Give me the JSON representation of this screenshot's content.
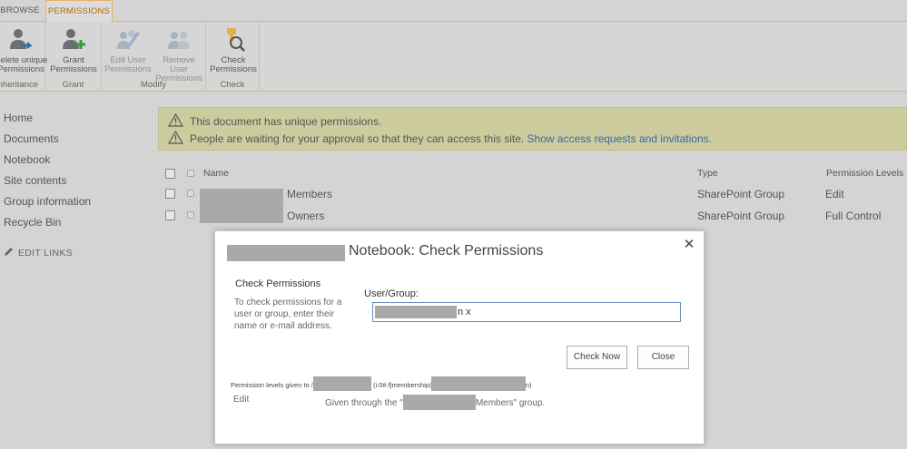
{
  "tabs": {
    "browse": "BROWSE",
    "permissions": "PERMISSIONS"
  },
  "ribbon": {
    "groups": [
      {
        "name": "Inheritance",
        "buttons": [
          {
            "line1": "Delete unique",
            "line2": "Permissions"
          }
        ]
      },
      {
        "name": "Grant",
        "buttons": [
          {
            "line1": "Grant",
            "line2": "Permissions"
          }
        ]
      },
      {
        "name": "Modify",
        "buttons": [
          {
            "line1": "Edit User",
            "line2": "Permissions"
          },
          {
            "line1": "Remove User",
            "line2": "Permissions"
          }
        ]
      },
      {
        "name": "Check",
        "buttons": [
          {
            "line1": "Check",
            "line2": "Permissions"
          }
        ]
      }
    ]
  },
  "nav": {
    "items": [
      "Home",
      "Documents",
      "Notebook",
      "Site contents",
      "Group information",
      "Recycle Bin"
    ],
    "edit_links": "EDIT LINKS"
  },
  "status": {
    "line1": "This document has unique permissions.",
    "line2_text": "People are waiting for your approval so that they can access this site.",
    "line2_link": "Show access requests and invitations."
  },
  "table": {
    "headers": {
      "name": "Name",
      "type": "Type",
      "permission_levels": "Permission Levels"
    },
    "rows": [
      {
        "name_suffix": "Members",
        "type": "SharePoint Group",
        "level": "Edit"
      },
      {
        "name_suffix": "Owners",
        "type": "SharePoint Group",
        "level": "Full Control"
      }
    ]
  },
  "dialog": {
    "title": "Notebook: Check Permissions",
    "close_glyph": "✕",
    "section_title": "Check Permissions",
    "description": "To check permissions for a user or group, enter their name or e-mail address.",
    "field_label": "User/Group:",
    "field_value_visible": "n x",
    "check_now": "Check Now",
    "close": "Close",
    "result_prefix": "Permission levels given to /",
    "result_middle": "(i:0#.f|membership|",
    "result_suffix": "n)",
    "result_level": "Edit",
    "result_given_prefix": "Given through the \"",
    "result_given_suffix": "Members\" group."
  },
  "colors": {
    "accent": "#e8b169",
    "tab_active_text": "#b06a00",
    "link": "#3568a6",
    "status_bg": "#cdcc9f"
  }
}
